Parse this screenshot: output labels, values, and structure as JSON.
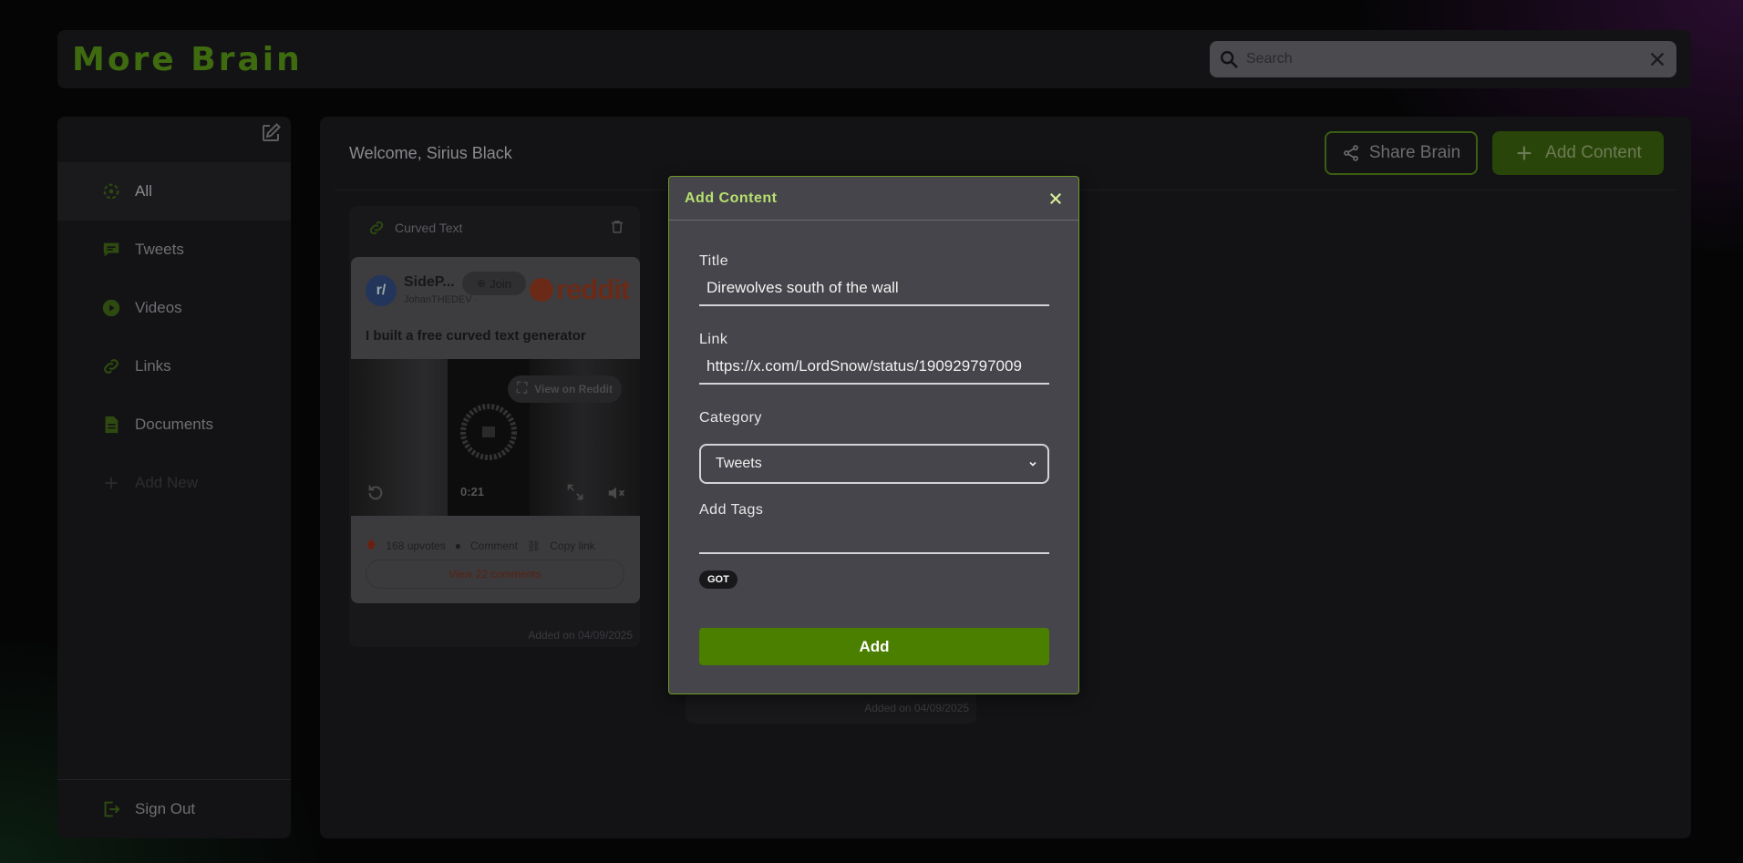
{
  "app": {
    "title": "More Brain"
  },
  "search": {
    "placeholder": "Search"
  },
  "sidebar": {
    "items": [
      {
        "label": "All",
        "icon": "all-icon"
      },
      {
        "label": "Tweets",
        "icon": "tweet-icon"
      },
      {
        "label": "Videos",
        "icon": "video-icon"
      },
      {
        "label": "Links",
        "icon": "link-icon"
      },
      {
        "label": "Documents",
        "icon": "document-icon"
      },
      {
        "label": "Add New",
        "icon": "plus-icon"
      }
    ],
    "signout": "Sign Out"
  },
  "main": {
    "welcome": "Welcome, Sirius Black",
    "share_label": "Share Brain",
    "add_label": "Add Content"
  },
  "card": {
    "title": "Curved Text",
    "reddit": {
      "avatar": "r/",
      "subreddit": "SideP...",
      "join": "Join",
      "user": "JohanTHEDEV ·",
      "brand": "reddit",
      "post_title": "I built a free curved text generator",
      "view_on": "View on Reddit",
      "time": "0:21",
      "upvotes": "168 upvotes",
      "comment": "Comment",
      "copy_link": "Copy link",
      "view_comments": "View 22 comments"
    },
    "date": "Added on 04/09/2025"
  },
  "card2": {
    "date": "Added on 04/09/2025"
  },
  "modal": {
    "title": "Add Content",
    "title_label": "Title",
    "title_value": "Direwolves south of the wall",
    "link_label": "Link",
    "link_value": "https://x.com/LordSnow/status/190929797009",
    "category_label": "Category",
    "category_value": "Tweets",
    "tags_label": "Add Tags",
    "tags_value": "",
    "tags": [
      "GOT"
    ],
    "submit_label": "Add"
  },
  "colors": {
    "accent": "#4b7f00",
    "modal_title": "#b7e070",
    "modal_border": "#6f9a24"
  }
}
